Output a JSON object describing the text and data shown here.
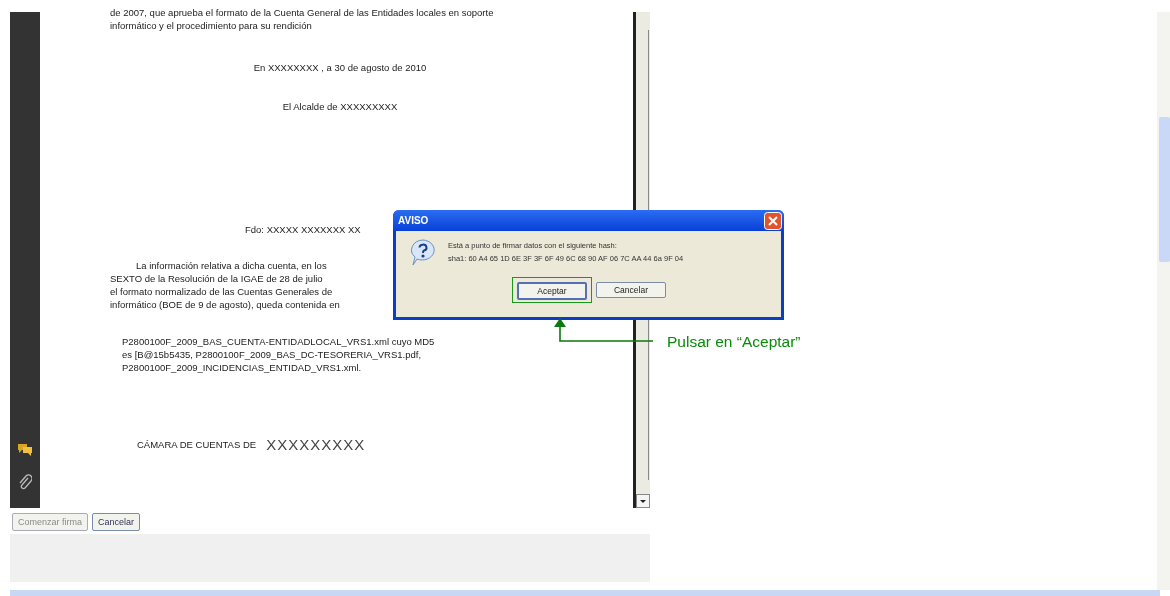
{
  "document": {
    "intro_lines": [
      "de 2007, que aprueba el formato de la Cuenta General de las Entidades locales en soporte",
      "informático y el procedimiento para su rendición"
    ],
    "place_date": "En XXXXXXXX , a 30 de agosto de 2010",
    "signer": "El Alcalde de XXXXXXXXX",
    "signature": "Fdo: XXXXX XXXXXXX XX",
    "paragraph_lines": [
      "La información relativa a dicha cuenta, en los",
      "SEXTO de la Resolución de la IGAE de 28 de julio",
      "el formato normalizado de las Cuentas Generales de",
      "informático (BOE de 9 de agosto), queda contenida en"
    ],
    "file_lines": [
      "P2800100F_2009_BAS_CUENTA-ENTIDADLOCAL_VRS1.xml cuyo MD5",
      "es [B@15b5435, P2800100F_2009_BAS_DC-TESORERIA_VRS1.pdf,",
      "P2800100F_2009_INCIDENCIAS_ENTIDAD_VRS1.xml."
    ],
    "closing_label": "CÁMARA DE CUENTAS DE",
    "closing_name": "XXXXXXXXX"
  },
  "buttons": [
    {
      "label": "Comenzar firma",
      "disabled": true
    },
    {
      "label": "Cancelar",
      "disabled": false
    }
  ],
  "dialog": {
    "title": "AVISO",
    "message_lines": [
      "Está a punto de firmar datos con el siguiente hash:",
      "sha1: 60 A4 65 1D 6E 3F 3F 6F 49 6C 68 90 AF 06 7C AA 44 6a 9F 04"
    ],
    "buttons": [
      {
        "label": "Aceptar",
        "selected": true
      },
      {
        "label": "Cancelar",
        "selected": false
      }
    ]
  },
  "callout": "Pulsar en “Aceptar”"
}
